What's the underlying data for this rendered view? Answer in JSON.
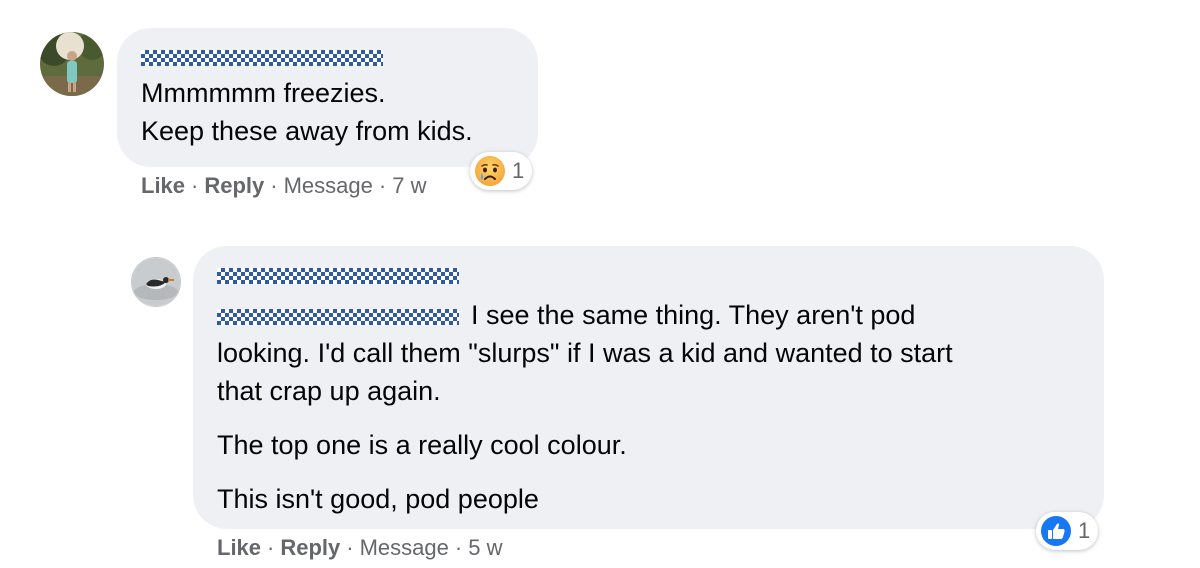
{
  "comments": [
    {
      "text_lines": [
        "Mmmmmm freezies.",
        "Keep these away from kids."
      ],
      "actions": {
        "like": "Like",
        "reply": "Reply",
        "message": "Message",
        "time": "7 w"
      },
      "reaction": {
        "icon": "sad-emoji-icon",
        "count": "1"
      }
    },
    {
      "first_line_text": "I see the same thing. They aren't pod",
      "continuation_lines": [
        "looking. I'd call them \"slurps\" if I was a kid and wanted to start",
        "that crap up again."
      ],
      "paragraph_2": "The top one is a really cool colour.",
      "paragraph_3": "This isn't good, pod people",
      "actions": {
        "like": "Like",
        "reply": "Reply",
        "message": "Message",
        "time": "5 w"
      },
      "reaction": {
        "icon": "like-thumb-icon",
        "count": "1"
      }
    }
  ],
  "separator": "·",
  "colors": {
    "bubble": "#eef0f4",
    "censor": "#2e5aa8",
    "meta": "#65676b",
    "like_blue": "#1877f2"
  }
}
